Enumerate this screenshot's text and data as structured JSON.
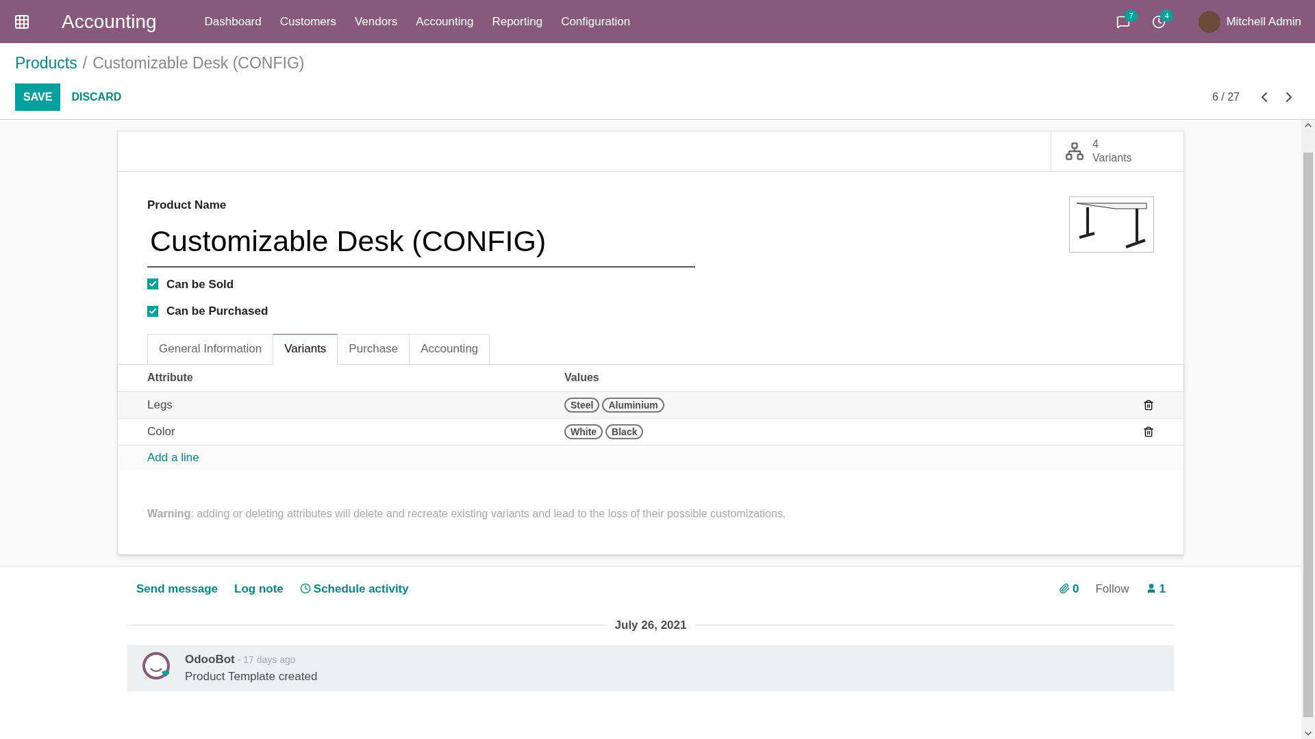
{
  "navbar": {
    "app_name": "Accounting",
    "menu": [
      "Dashboard",
      "Customers",
      "Vendors",
      "Accounting",
      "Reporting",
      "Configuration"
    ],
    "messages_count": "7",
    "activities_count": "4",
    "user": "Mitchell Admin"
  },
  "breadcrumb": {
    "parent": "Products",
    "separator": "/",
    "current": "Customizable Desk (CONFIG)"
  },
  "actions": {
    "save": "SAVE",
    "discard": "DISCARD"
  },
  "pager": "6 / 27",
  "button_box": {
    "count": "4",
    "label": "Variants"
  },
  "product": {
    "name_label": "Product Name",
    "name": "Customizable Desk (CONFIG)",
    "flags": [
      {
        "label": "Can be Sold",
        "checked": true
      },
      {
        "label": "Can be Purchased",
        "checked": true
      }
    ]
  },
  "tabs": [
    {
      "label": "General Information",
      "selected": false
    },
    {
      "label": "Variants",
      "selected": true
    },
    {
      "label": "Purchase",
      "selected": false
    },
    {
      "label": "Accounting",
      "selected": false
    }
  ],
  "table": {
    "columns": [
      "Attribute",
      "Values"
    ],
    "rows": [
      {
        "attribute": "Legs",
        "values": [
          "Steel",
          "Aluminium"
        ]
      },
      {
        "attribute": "Color",
        "values": [
          "White",
          "Black"
        ]
      }
    ],
    "add_line": "Add a line"
  },
  "warning": {
    "prefix": "Warning",
    "text": ": adding or deleting attributes will delete and recreate existing variants and lead to the loss of their possible customizations."
  },
  "chatter": {
    "send_message": "Send message",
    "log_note": "Log note",
    "schedule_activity": "Schedule activity",
    "attachments": "0",
    "follow": "Follow",
    "followers": "1",
    "date": "July 26, 2021",
    "messages": [
      {
        "author": "OdooBot",
        "time": "- 17 days ago",
        "body": "Product Template created"
      }
    ]
  }
}
